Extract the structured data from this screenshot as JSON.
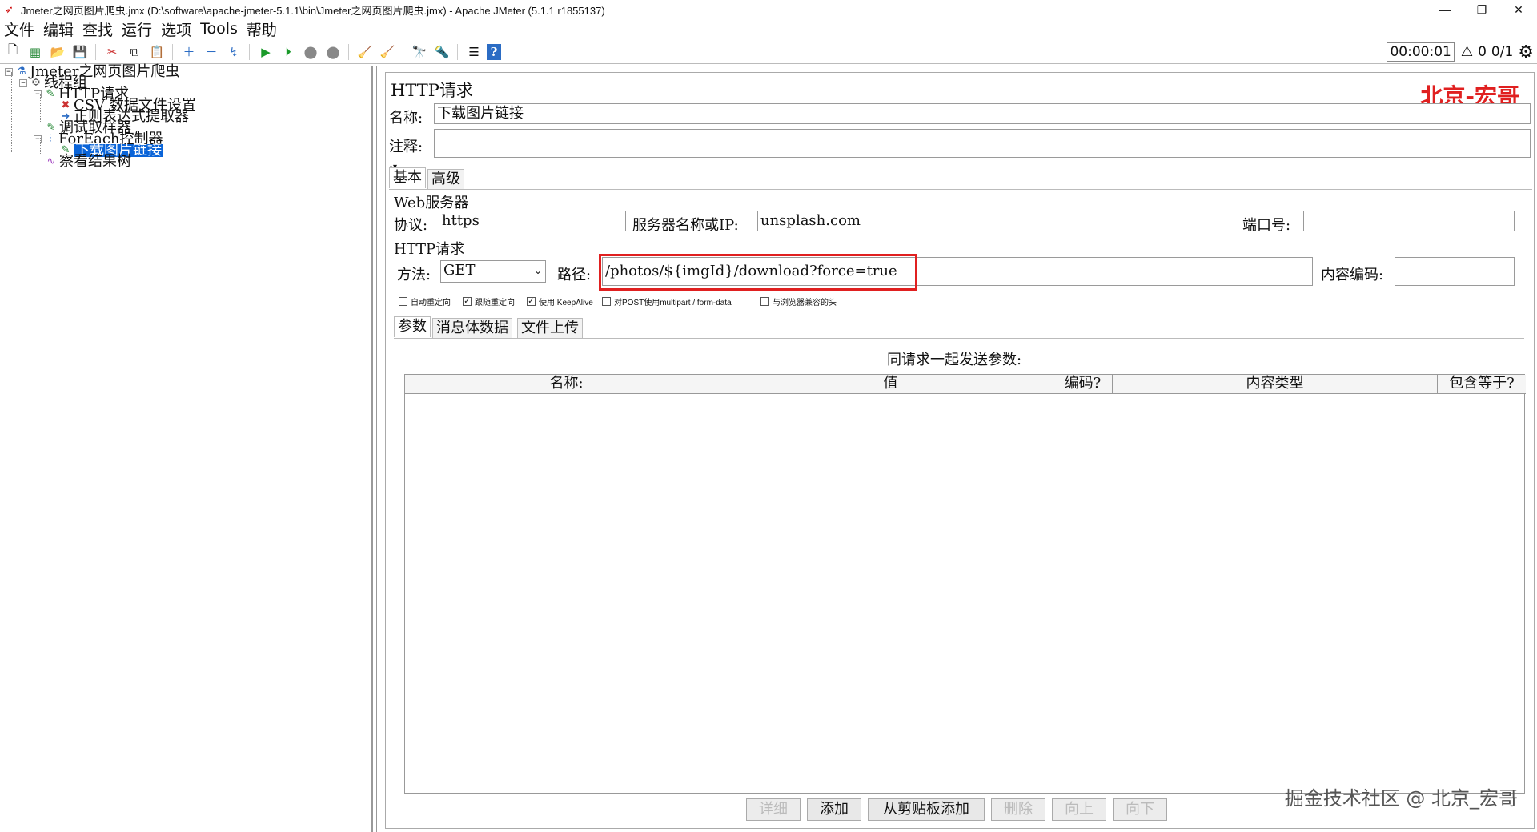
{
  "window": {
    "title": "Jmeter之网页图片爬虫.jmx (D:\\software\\apache-jmeter-5.1.1\\bin\\Jmeter之网页图片爬虫.jmx) - Apache JMeter (5.1.1 r1855137)",
    "minimize": "—",
    "restore": "❐",
    "close": "✕"
  },
  "menu": [
    "文件",
    "编辑",
    "查找",
    "运行",
    "选项",
    "Tools",
    "帮助"
  ],
  "toolbar": {
    "timer": "00:00:01",
    "warnings": "0",
    "threads": "0/1"
  },
  "tree": {
    "root": "Jmeter之网页图片爬虫",
    "thread_group": "线程组",
    "http_request": "HTTP请求",
    "csv": "CSV 数据文件设置",
    "regex": "正则表达式提取器",
    "debug": "调试取样器",
    "foreach": "ForEach控制器",
    "download": "下载图片链接",
    "results": "察看结果树"
  },
  "panel": {
    "heading": "HTTP请求",
    "brand": "北京-宏哥",
    "name_label": "名称:",
    "name_value": "下载图片链接",
    "comment_label": "注释:",
    "comment_value": "",
    "tabs": [
      "基本",
      "高级"
    ],
    "web_server_title": "Web服务器",
    "protocol_label": "协议:",
    "protocol_value": "https",
    "server_label": "服务器名称或IP:",
    "server_value": "unsplash.com",
    "port_label": "端口号:",
    "port_value": "",
    "http_request_title": "HTTP请求",
    "method_label": "方法:",
    "method_value": "GET",
    "path_label": "路径:",
    "path_value": "/photos/${imgId}/download?force=true",
    "encoding_label": "内容编码:",
    "encoding_value": "",
    "checkboxes": [
      {
        "label": "自动重定向",
        "checked": false
      },
      {
        "label": "跟随重定向",
        "checked": true
      },
      {
        "label": "使用 KeepAlive",
        "checked": true
      },
      {
        "label": "对POST使用multipart / form-data",
        "checked": false
      },
      {
        "label": "与浏览器兼容的头",
        "checked": false
      }
    ],
    "sub_tabs": [
      "参数",
      "消息体数据",
      "文件上传"
    ],
    "params_caption": "同请求一起发送参数:",
    "columns": [
      "名称:",
      "值",
      "编码?",
      "内容类型",
      "包含等于?"
    ],
    "buttons": [
      "详细",
      "添加",
      "从剪贴板添加",
      "删除",
      "向上",
      "向下"
    ],
    "watermark": "掘金技术社区 @ 北京_宏哥"
  }
}
